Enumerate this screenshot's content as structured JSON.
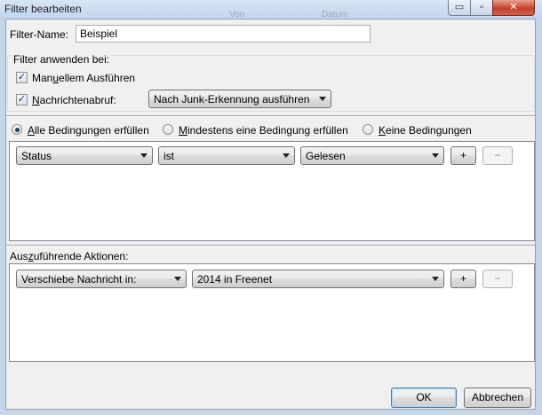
{
  "window": {
    "title": "Filter bearbeiten",
    "ghost_labels": [
      "Von",
      "Datum"
    ],
    "min_glyph": "▭",
    "max_glyph": "▫",
    "close_glyph": "✕"
  },
  "filter_name": {
    "label": "Filter-Name:",
    "value": "Beispiel"
  },
  "apply_group": {
    "title": "Filter anwenden bei:",
    "manual": {
      "label_pre": "Man",
      "label_ul": "u",
      "label_post": "ellem Ausführen",
      "checked": true
    },
    "fetch": {
      "label_pre": "",
      "label_ul": "N",
      "label_post": "achrichtenabruf:",
      "checked": true
    },
    "fetch_option": "Nach Junk-Erkennung ausführen"
  },
  "match_options": [
    {
      "pre": "",
      "ul": "A",
      "post": "lle Bedingungen erfüllen",
      "selected": true
    },
    {
      "pre": "",
      "ul": "M",
      "post": "indestens eine Bedingung erfüllen",
      "selected": false
    },
    {
      "pre": "",
      "ul": "K",
      "post": "eine Bedingungen",
      "selected": false
    }
  ],
  "condition": {
    "field": "Status",
    "operator": "ist",
    "value": "Gelesen",
    "add_label": "+",
    "remove_label": "−"
  },
  "actions": {
    "label_pre": "Aus",
    "label_ul": "z",
    "label_post": "uführende Aktionen:",
    "action": "Verschiebe Nachricht in:",
    "target": "2014 in Freenet",
    "add_label": "+",
    "remove_label": "−"
  },
  "footer": {
    "ok_label": "OK",
    "cancel_label": "Abbrechen"
  },
  "check_glyph": "✓"
}
